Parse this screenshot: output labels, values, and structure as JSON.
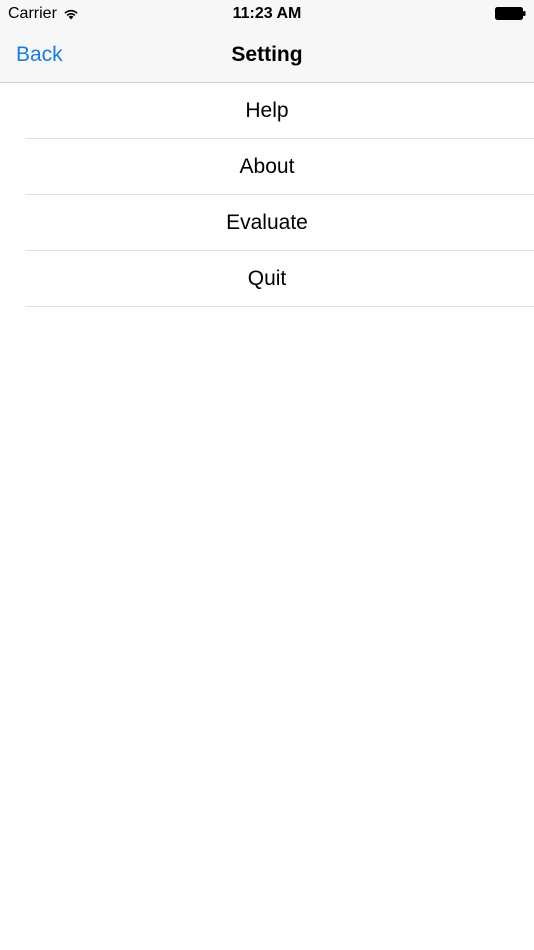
{
  "status_bar": {
    "carrier": "Carrier",
    "time": "11:23 AM",
    "wifi_icon": "wifi-icon",
    "battery_icon": "battery-icon"
  },
  "nav_bar": {
    "back_label": "Back",
    "title": "Setting"
  },
  "menu": {
    "items": [
      {
        "label": "Help"
      },
      {
        "label": "About"
      },
      {
        "label": "Evaluate"
      },
      {
        "label": "Quit"
      }
    ]
  },
  "colors": {
    "accent": "#1a7ee0",
    "bar_background": "#f7f7f7",
    "separator": "#e0e0e0"
  }
}
